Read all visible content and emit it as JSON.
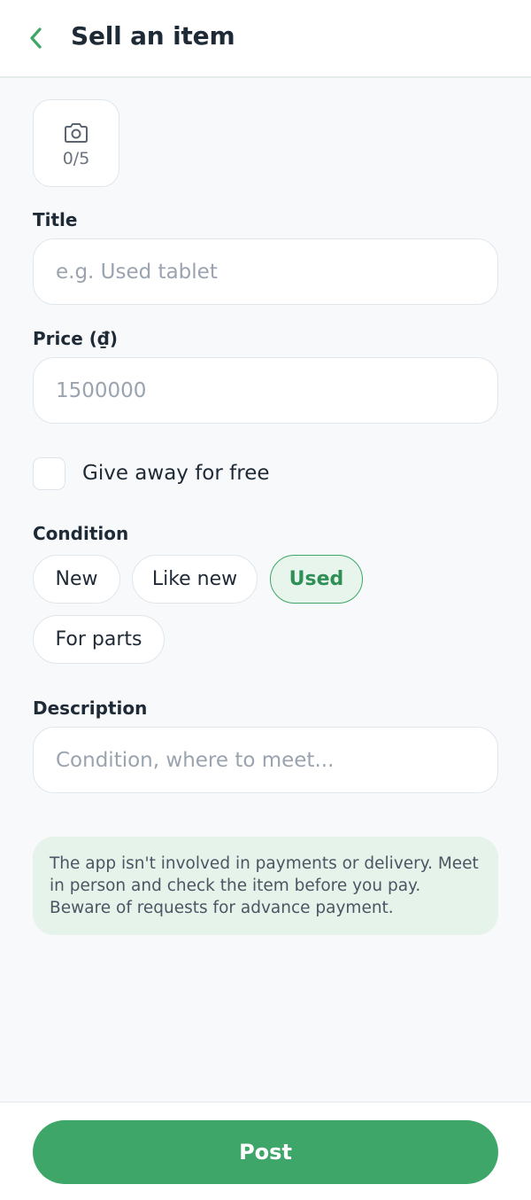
{
  "header": {
    "title": "Sell an item"
  },
  "photos": {
    "count": "0/5"
  },
  "title_field": {
    "label": "Title",
    "placeholder": "e.g. Used tablet"
  },
  "price_field": {
    "label": "Price (₫)",
    "placeholder": "1500000"
  },
  "free_toggle": {
    "label": "Give away for free",
    "checked": false
  },
  "condition": {
    "label": "Condition",
    "options": [
      "New",
      "Like new",
      "Used",
      "For parts"
    ],
    "selected": "Used"
  },
  "description_field": {
    "label": "Description",
    "placeholder": "Condition, where to meet..."
  },
  "notice": {
    "text": "The app isn't involved in payments or delivery. Meet in person and check the item before you pay. Beware of requests for advance payment."
  },
  "footer": {
    "post_label": "Post"
  },
  "colors": {
    "accent": "#3ea668",
    "accent_light": "#e8f5ec",
    "notice_bg": "#e6f3ea"
  },
  "icons": {
    "back": "chevron-left-icon",
    "photo": "camera-icon"
  }
}
